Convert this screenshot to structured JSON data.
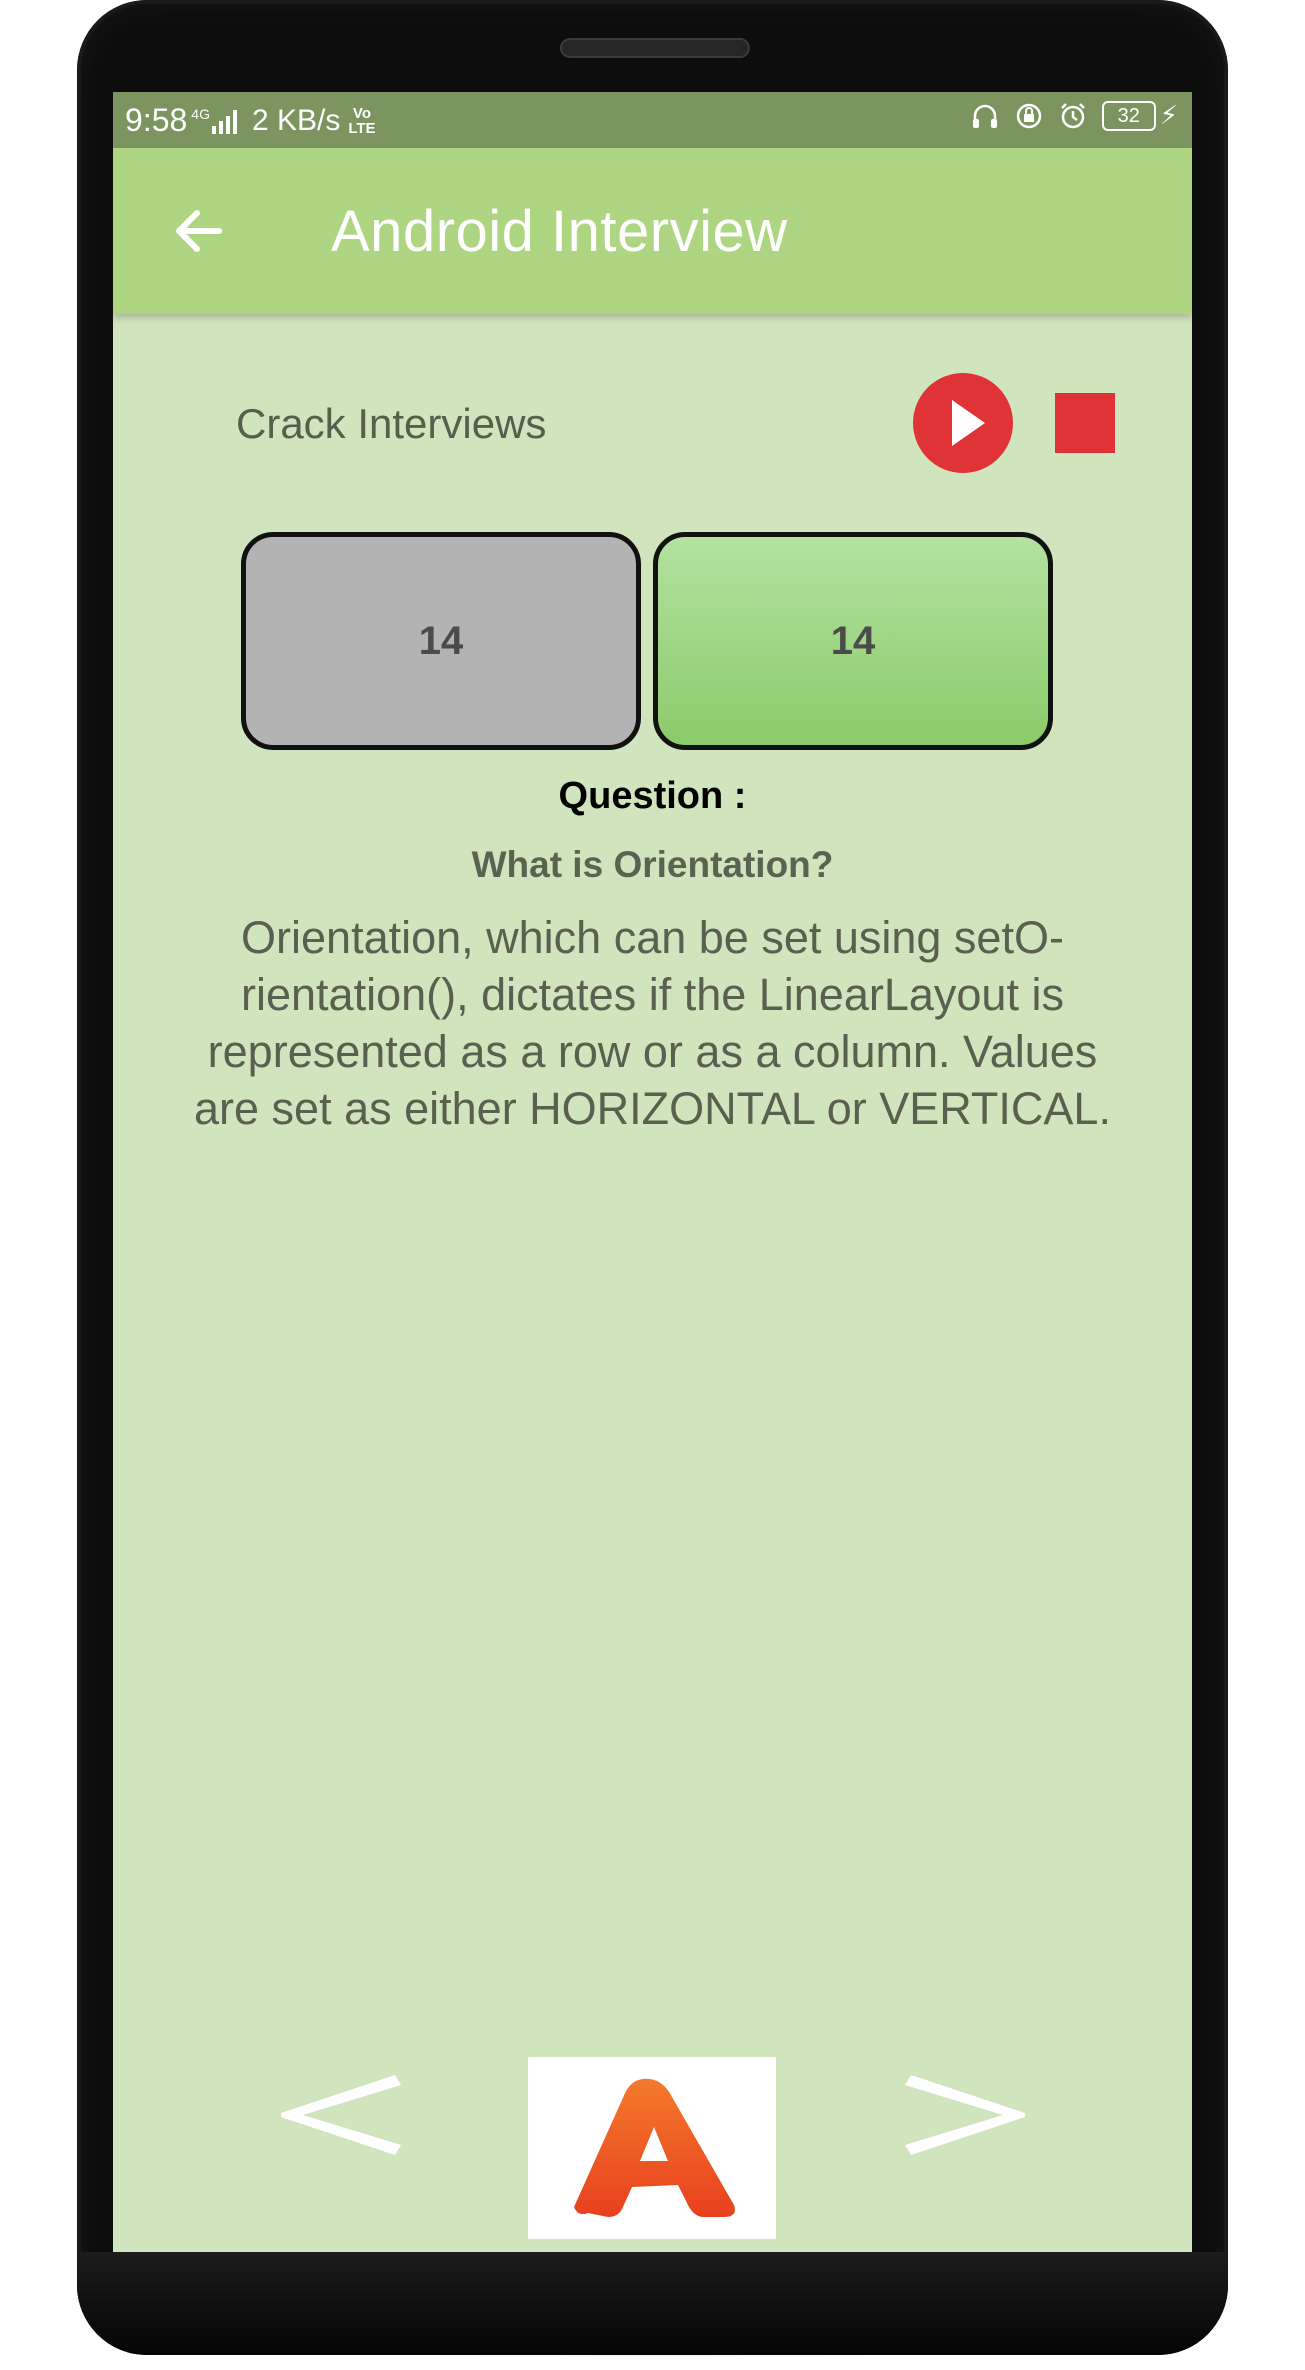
{
  "status_bar": {
    "time": "9:58",
    "network_type": "4G",
    "net_speed": "2 KB/s",
    "volte": "Vo\nLTE",
    "battery": "32",
    "icons": [
      "headphones-icon",
      "lock-rotation-icon",
      "alarm-icon",
      "battery-icon",
      "charging-icon"
    ]
  },
  "app_bar": {
    "title": "Android Interview",
    "back_icon": "arrow-back-icon"
  },
  "header": {
    "subtitle": "Crack Interviews",
    "play_icon": "play-icon",
    "stop_icon": "stop-icon"
  },
  "counters": {
    "total": "14",
    "current": "14"
  },
  "content": {
    "question_label": "Question :",
    "question": "What is Orientation?",
    "answer": "Orientation, which can be set using setO-rientation(), dictates if the LinearLayout is represented as a row or as a column. Values are set as either HORIZONTAL or VERTICAL."
  },
  "navigation": {
    "prev_icon": "chevron-left-icon",
    "next_icon": "chevron-right-icon",
    "logo_icon": "app-logo-icon"
  },
  "colors": {
    "status_bar": "#7b9460",
    "app_bar": "#aed581",
    "background": "#d0e4bd",
    "accent_red": "#e03337",
    "counter_grey": "#b3b3b3",
    "counter_green": "#8bca6a",
    "logo_orange": "#f05a24"
  }
}
